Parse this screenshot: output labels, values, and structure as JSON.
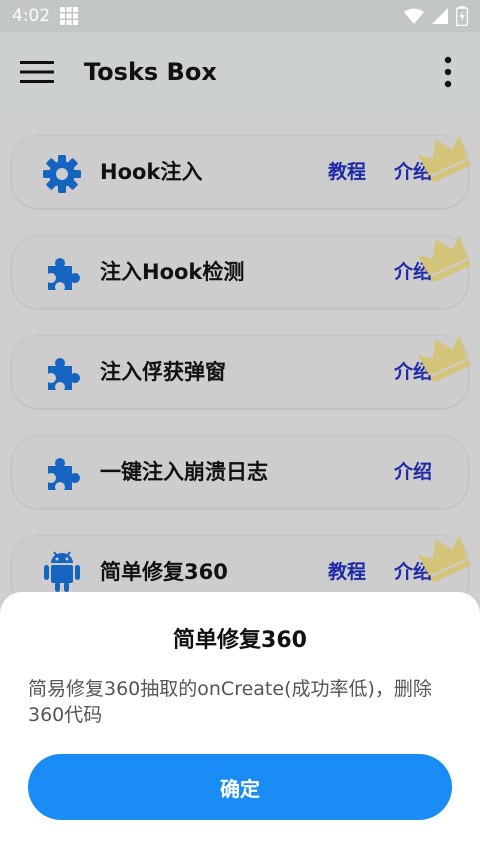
{
  "status_bar": {
    "time": "4:02"
  },
  "app_bar": {
    "title": "Tosks Box"
  },
  "cards": [
    {
      "label": "Hook注入",
      "tutorial": "教程",
      "intro": "介绍",
      "icon": "gear-icon"
    },
    {
      "label": "注入Hook检测",
      "tutorial": "",
      "intro": "介绍",
      "icon": "puzzle-icon"
    },
    {
      "label": "注入俘获弹窗",
      "tutorial": "",
      "intro": "介绍",
      "icon": "puzzle-icon"
    },
    {
      "label": "一键注入崩溃日志",
      "tutorial": "",
      "intro": "介绍",
      "icon": "puzzle-icon"
    },
    {
      "label": "简单修复360",
      "tutorial": "教程",
      "intro": "介绍",
      "icon": "android-icon"
    }
  ],
  "dialog": {
    "title": "简单修复360",
    "body": "简易修复360抽取的onCreate(成功率低)，删除360代码",
    "confirm_label": "确定"
  },
  "colors": {
    "accent": "#1a8cf5",
    "icon_blue": "#1565c0",
    "link_blue": "#1e2aa6",
    "crown": "#d4c47a"
  }
}
